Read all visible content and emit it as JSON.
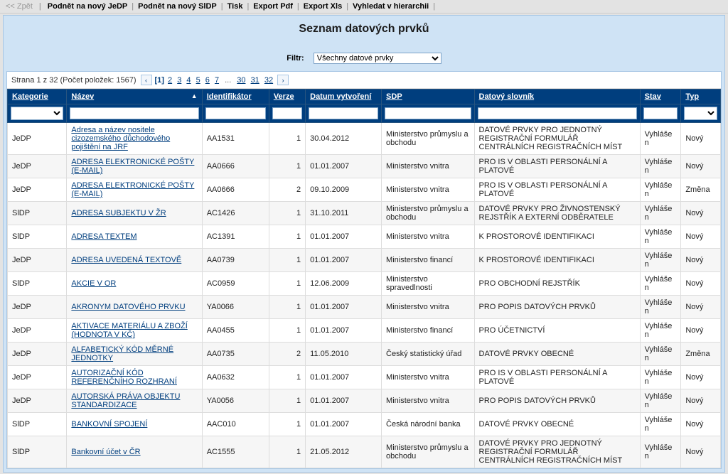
{
  "toolbar": {
    "back": "<< Zpět",
    "items": [
      "Podnět na nový JeDP",
      "Podnět na nový SlDP",
      "Tisk",
      "Export Pdf",
      "Export Xls",
      "Vyhledat v hierarchii"
    ]
  },
  "title": "Seznam datových prvků",
  "filter": {
    "label": "Filtr:",
    "value": "Všechny datové prvky"
  },
  "pager": {
    "info": "Strana 1 z 32 (Počet položek: 1567)",
    "pages_first": [
      "[1]",
      "2",
      "3",
      "4",
      "5",
      "6",
      "7"
    ],
    "ellipsis": "...",
    "pages_last": [
      "30",
      "31",
      "32"
    ]
  },
  "columns": {
    "kategorie": "Kategorie",
    "nazev": "Název",
    "identifikator": "Identifikátor",
    "verze": "Verze",
    "datum": "Datum vytvoření",
    "sdp": "SDP",
    "slovnik": "Datový slovník",
    "stav": "Stav",
    "typ": "Typ"
  },
  "rows": [
    {
      "kategorie": "JeDP",
      "nazev": "Adresa a název nositele cizozemského důchodového pojištění na JRF",
      "id": "AA1531",
      "verze": "1",
      "datum": "30.04.2012",
      "sdp": "Ministerstvo průmyslu a obchodu",
      "slovnik": "DATOVÉ PRVKY PRO JEDNOTNÝ REGISTRAČNÍ FORMULÁŘ CENTRÁLNÍCH REGISTRAČNÍCH MÍST",
      "stav": "Vyhlášen",
      "typ": "Nový"
    },
    {
      "kategorie": "JeDP",
      "nazev": "ADRESA ELEKTRONICKÉ POŠTY (E-MAIL)",
      "id": "AA0666",
      "verze": "1",
      "datum": "01.01.2007",
      "sdp": "Ministerstvo vnitra",
      "slovnik": "PRO IS V OBLASTI PERSONÁLNÍ A PLATOVÉ",
      "stav": "Vyhlášen",
      "typ": "Nový"
    },
    {
      "kategorie": "JeDP",
      "nazev": "ADRESA ELEKTRONICKÉ POŠTY (E-MAIL)",
      "id": "AA0666",
      "verze": "2",
      "datum": "09.10.2009",
      "sdp": "Ministerstvo vnitra",
      "slovnik": "PRO IS V OBLASTI PERSONÁLNÍ A PLATOVÉ",
      "stav": "Vyhlášen",
      "typ": "Změna"
    },
    {
      "kategorie": "SlDP",
      "nazev": "ADRESA SUBJEKTU V ŽR",
      "id": "AC1426",
      "verze": "1",
      "datum": "31.10.2011",
      "sdp": "Ministerstvo průmyslu a obchodu",
      "slovnik": "DATOVÉ PRVKY PRO ŽIVNOSTENSKÝ REJSTŘÍK A EXTERNÍ ODBĚRATELE",
      "stav": "Vyhlášen",
      "typ": "Nový"
    },
    {
      "kategorie": "SlDP",
      "nazev": "ADRESA TEXTEM",
      "id": "AC1391",
      "verze": "1",
      "datum": "01.01.2007",
      "sdp": "Ministerstvo vnitra",
      "slovnik": "K PROSTOROVÉ IDENTIFIKACI",
      "stav": "Vyhlášen",
      "typ": "Nový"
    },
    {
      "kategorie": "JeDP",
      "nazev": "ADRESA UVEDENÁ TEXTOVĚ",
      "id": "AA0739",
      "verze": "1",
      "datum": "01.01.2007",
      "sdp": "Ministerstvo financí",
      "slovnik": "K PROSTOROVÉ IDENTIFIKACI",
      "stav": "Vyhlášen",
      "typ": "Nový"
    },
    {
      "kategorie": "SlDP",
      "nazev": "AKCIE V OR",
      "id": "AC0959",
      "verze": "1",
      "datum": "12.06.2009",
      "sdp": "Ministerstvo spravedlnosti",
      "slovnik": "PRO OBCHODNÍ REJSTŘÍK",
      "stav": "Vyhlášen",
      "typ": "Nový"
    },
    {
      "kategorie": "JeDP",
      "nazev": "AKRONYM DATOVÉHO PRVKU",
      "id": "YA0066",
      "verze": "1",
      "datum": "01.01.2007",
      "sdp": "Ministerstvo vnitra",
      "slovnik": "PRO POPIS DATOVÝCH PRVKŮ",
      "stav": "Vyhlášen",
      "typ": "Nový"
    },
    {
      "kategorie": "JeDP",
      "nazev": "AKTIVACE MATERIÁLU A ZBOŽÍ (HODNOTA V KČ)",
      "id": "AA0455",
      "verze": "1",
      "datum": "01.01.2007",
      "sdp": "Ministerstvo financí",
      "slovnik": "PRO ÚČETNICTVÍ",
      "stav": "Vyhlášen",
      "typ": "Nový"
    },
    {
      "kategorie": "JeDP",
      "nazev": "ALFABETICKÝ KÓD MĚRNÉ JEDNOTKY",
      "id": "AA0735",
      "verze": "2",
      "datum": "11.05.2010",
      "sdp": "Český statistický úřad",
      "slovnik": "DATOVÉ PRVKY OBECNÉ",
      "stav": "Vyhlášen",
      "typ": "Změna"
    },
    {
      "kategorie": "JeDP",
      "nazev": "AUTORIZAČNÍ KÓD REFERENČNÍHO ROZHRANÍ",
      "id": "AA0632",
      "verze": "1",
      "datum": "01.01.2007",
      "sdp": "Ministerstvo vnitra",
      "slovnik": "PRO IS V OBLASTI PERSONÁLNÍ A PLATOVÉ",
      "stav": "Vyhlášen",
      "typ": "Nový"
    },
    {
      "kategorie": "JeDP",
      "nazev": "AUTORSKÁ PRÁVA OBJEKTU STANDARDIZACE",
      "id": "YA0056",
      "verze": "1",
      "datum": "01.01.2007",
      "sdp": "Ministerstvo vnitra",
      "slovnik": "PRO POPIS DATOVÝCH PRVKŮ",
      "stav": "Vyhlášen",
      "typ": "Nový"
    },
    {
      "kategorie": "SlDP",
      "nazev": "BANKOVNÍ SPOJENÍ",
      "id": "AAC010",
      "verze": "1",
      "datum": "01.01.2007",
      "sdp": "Česká národní banka",
      "slovnik": "DATOVÉ PRVKY OBECNÉ",
      "stav": "Vyhlášen",
      "typ": "Nový"
    },
    {
      "kategorie": "SlDP",
      "nazev": "Bankovní účet v ČR",
      "id": "AC1555",
      "verze": "1",
      "datum": "21.05.2012",
      "sdp": "Ministerstvo průmyslu a obchodu",
      "slovnik": "DATOVÉ PRVKY PRO JEDNOTNÝ REGISTRAČNÍ FORMULÁŘ CENTRÁLNÍCH REGISTRAČNÍCH MÍST",
      "stav": "Vyhlášen",
      "typ": "Nový"
    }
  ]
}
